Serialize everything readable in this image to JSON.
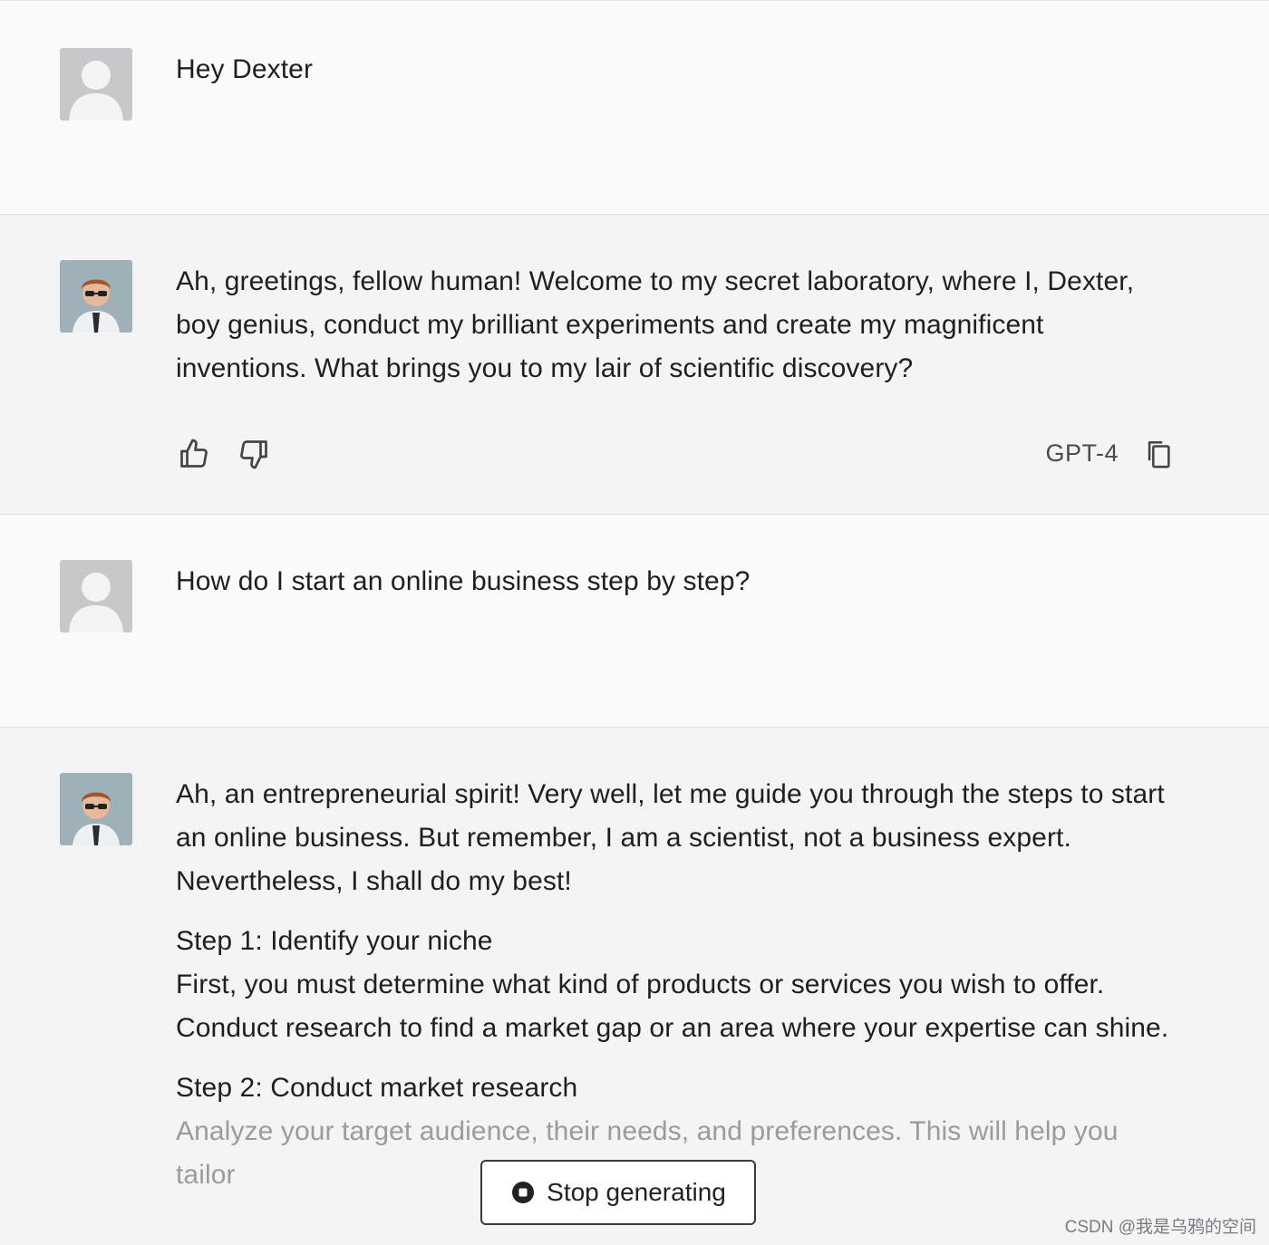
{
  "conversation": {
    "messages": [
      {
        "role": "user",
        "paragraphs": [
          "Hey Dexter"
        ]
      },
      {
        "role": "assistant",
        "paragraphs": [
          "Ah, greetings, fellow human! Welcome to my secret laboratory, where I, Dexter, boy genius, conduct my brilliant experiments and create my magnificent inventions. What brings you to my lair of scientific discovery?"
        ]
      },
      {
        "role": "user",
        "paragraphs": [
          "How do I start an online business step by step?"
        ]
      },
      {
        "role": "assistant",
        "paragraphs": [
          "Ah, an entrepreneurial spirit! Very well, let me guide you through the steps to start an online business. But remember, I am a scientist, not a business expert. Nevertheless, I shall do my best!",
          "Step 1: Identify your niche\nFirst, you must determine what kind of products or services you wish to offer. Conduct research to find a market gap or an area where your expertise can shine.",
          "Step 2: Conduct market research",
          "Analyze your target audience, their needs, and preferences. This will help you tailor"
        ]
      }
    ]
  },
  "actions": {
    "thumbs_up_icon": "thumbs-up",
    "thumbs_down_icon": "thumbs-down",
    "model_label": "GPT-4",
    "copy_icon": "copy"
  },
  "stop_button": {
    "label": "Stop generating",
    "icon": "stop-circle"
  },
  "watermark": "CSDN @我是乌鸦的空间",
  "colors": {
    "user_bg": "#fbfbfc",
    "assistant_bg": "#f4f4f6",
    "text": "#1f1f1f"
  }
}
